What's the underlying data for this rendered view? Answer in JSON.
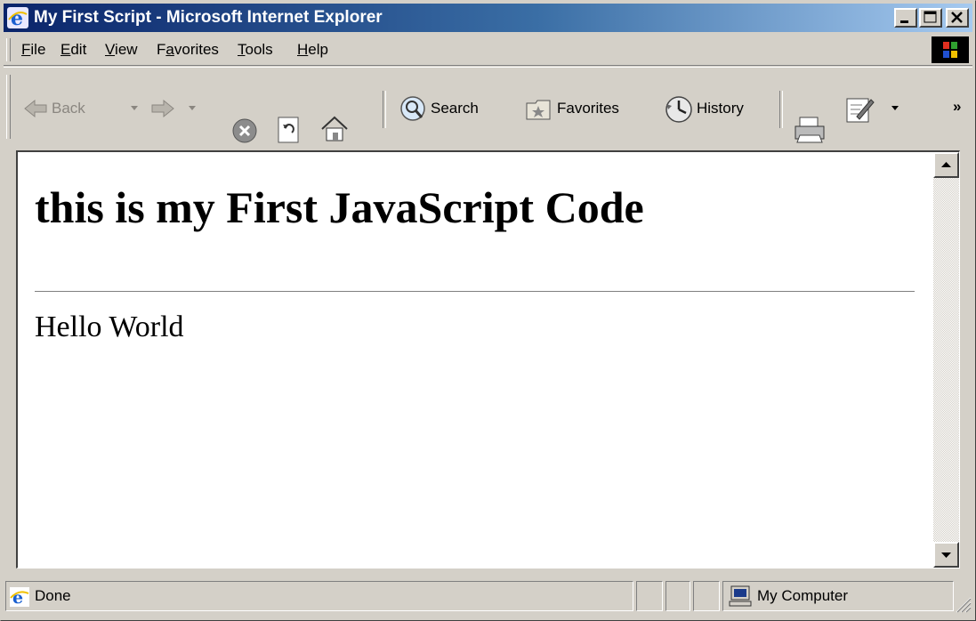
{
  "window": {
    "title": "My First Script - Microsoft Internet Explorer"
  },
  "menubar": {
    "items": [
      {
        "label": "File",
        "accel": "F"
      },
      {
        "label": "Edit",
        "accel": "E"
      },
      {
        "label": "View",
        "accel": "V"
      },
      {
        "label": "Favorites",
        "accel": "a"
      },
      {
        "label": "Tools",
        "accel": "T"
      },
      {
        "label": "Help",
        "accel": "H"
      }
    ]
  },
  "toolbar": {
    "back_label": "Back",
    "search_label": "Search",
    "favorites_label": "Favorites",
    "history_label": "History",
    "chevron": "»"
  },
  "page": {
    "heading": "this is my First JavaScript Code",
    "body_text": "Hello World"
  },
  "statusbar": {
    "status": "Done",
    "zone": "My Computer"
  },
  "colors": {
    "title_gradient_start": "#0a246a",
    "title_gradient_end": "#a6caf0",
    "face": "#d4d0c8"
  }
}
